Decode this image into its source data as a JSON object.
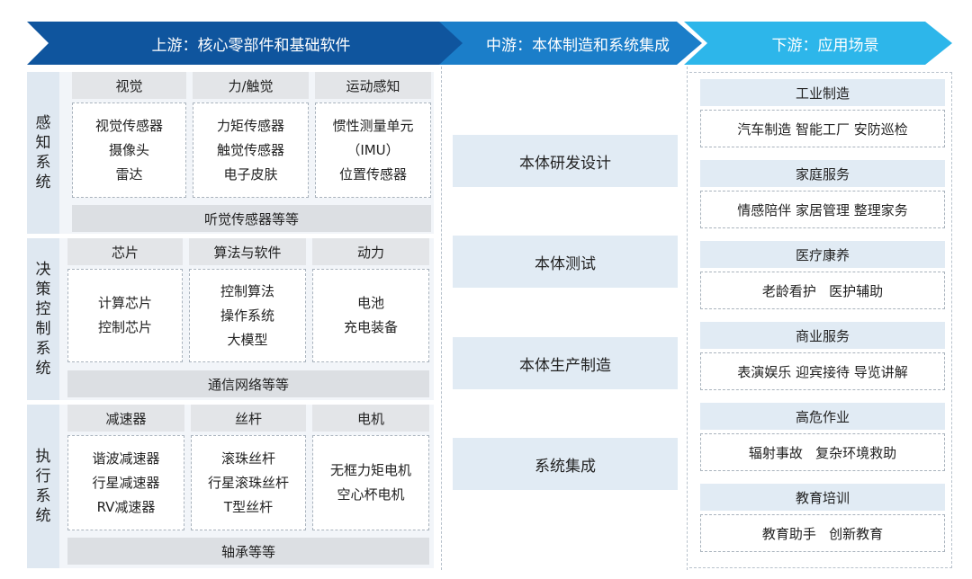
{
  "header": {
    "upstream": "上游：核心零部件和基础软件",
    "midstream": "中游：本体制造和系统集成",
    "downstream": "下游：应用场景"
  },
  "upstream": {
    "perception": {
      "side": "感知系统",
      "groups": [
        {
          "title": "视觉",
          "items": [
            "视觉传感器",
            "摄像头",
            "雷达"
          ]
        },
        {
          "title": "力/触觉",
          "items": [
            "力矩传感器",
            "触觉传感器",
            "电子皮肤"
          ]
        },
        {
          "title": "运动感知",
          "items": [
            "惯性测量单元",
            "（IMU）",
            "位置传感器"
          ]
        }
      ],
      "footer": "听觉传感器等等"
    },
    "decision": {
      "side": "决策控制系统",
      "groups": [
        {
          "title": "芯片",
          "items": [
            "计算芯片",
            "控制芯片"
          ]
        },
        {
          "title": "算法与软件",
          "items": [
            "控制算法",
            "操作系统",
            "大模型"
          ]
        },
        {
          "title": "动力",
          "items": [
            "电池",
            "充电装备"
          ]
        }
      ],
      "footer": "通信网络等等"
    },
    "execution": {
      "side": "执行系统",
      "groups": [
        {
          "title": "减速器",
          "items": [
            "谐波减速器",
            "行星减速器",
            "RV减速器"
          ]
        },
        {
          "title": "丝杆",
          "items": [
            "滚珠丝杆",
            "行星滚珠丝杆",
            "T型丝杆"
          ]
        },
        {
          "title": "电机",
          "items": [
            "无框力矩电机",
            "空心杯电机"
          ]
        }
      ],
      "footer": "轴承等等"
    }
  },
  "midstream": {
    "items": [
      "本体研发设计",
      "本体测试",
      "本体生产制造",
      "系统集成"
    ]
  },
  "downstream": {
    "items": [
      {
        "title": "工业制造",
        "detail": "汽车制造 智能工厂 安防巡检"
      },
      {
        "title": "家庭服务",
        "detail": "情感陪伴 家居管理 整理家务"
      },
      {
        "title": "医疗康养",
        "detail": "老龄看护   医护辅助"
      },
      {
        "title": "商业服务",
        "detail": "表演娱乐 迎宾接待 导览讲解"
      },
      {
        "title": "高危作业",
        "detail": "辐射事故   复杂环境救助"
      },
      {
        "title": "教育培训",
        "detail": "教育助手   创新教育"
      }
    ]
  },
  "colors": {
    "upstream": "#0f559e",
    "midstream": "#1b7ec9",
    "downstream": "#2db6ea",
    "panel": "#e1ebf4"
  }
}
